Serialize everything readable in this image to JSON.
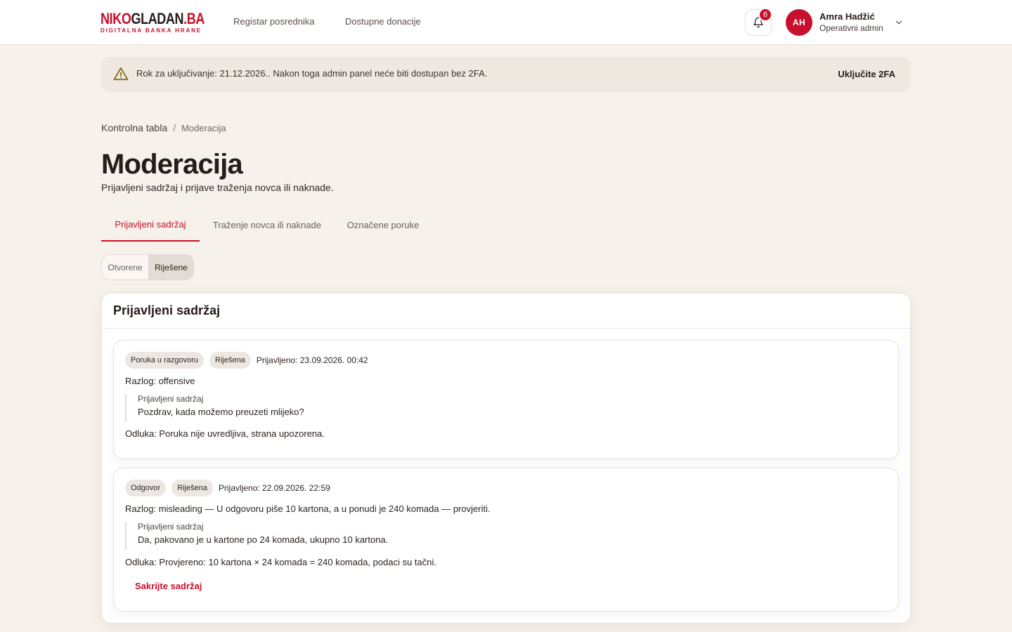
{
  "header": {
    "logo": {
      "part1": "NIKO",
      "part2": "GLADAN",
      "part3": ".BA",
      "tagline": "DIGITALNA BANKA HRANE"
    },
    "nav": [
      {
        "label": "Registar posrednika"
      },
      {
        "label": "Dostupne donacije"
      }
    ],
    "notifications": {
      "count": "6",
      "icon": "bell-icon"
    },
    "user": {
      "initials": "AH",
      "name": "Amra Hadžić",
      "role": "Operativni admin"
    }
  },
  "banner": {
    "icon": "warning-icon",
    "text": "Rok za uključivanje: 21.12.2026.. Nakon toga admin panel neće biti dostupan bez 2FA.",
    "action": "Uključite 2FA"
  },
  "breadcrumb": {
    "home": "Kontrolna tabla",
    "separator": "/",
    "current": "Moderacija"
  },
  "page": {
    "title": "Moderacija",
    "subtitle": "Prijavljeni sadržaj i prijave traženja novca ili naknade."
  },
  "tabs": [
    {
      "label": "Prijavljeni sadržaj",
      "active": true
    },
    {
      "label": "Traženje novca ili naknade",
      "active": false
    },
    {
      "label": "Označene poruke",
      "active": false
    }
  ],
  "status_filter": {
    "options": [
      "Otvorene",
      "Riješene"
    ],
    "selected": "Riješene"
  },
  "card": {
    "title": "Prijavljeni sadržaj",
    "reports": [
      {
        "type": "Poruka u razgovoru",
        "status": "Riješena",
        "reported_at": "Prijavljeno: 23.09.2026. 00:42",
        "reason": "Razlog: offensive",
        "quote_label": "Prijavljeni sadržaj",
        "quote_text": "Pozdrav, kada možemo preuzeti mlijeko?",
        "decision": "Odluka: Poruka nije uvredljiva, strana upozorena."
      },
      {
        "type": "Odgovor",
        "status": "Riješena",
        "reported_at": "Prijavljeno: 22.09.2026. 22:59",
        "reason": "Razlog: misleading — U odgovoru piše 10 kartona, a u ponudi je 240 komada — provjeriti.",
        "quote_label": "Prijavljeni sadržaj",
        "quote_text": "Da, pakovano je u kartone po 24 komada, ukupno 10 kartona.",
        "decision": "Odluka: Provjereno: 10 kartona × 24 komada = 240 komada, podaci su tačni.",
        "action": "Sakrijte sadržaj"
      }
    ]
  },
  "colors": {
    "brand": "#c8102e",
    "background": "#f6f1ea",
    "banner": "#efe8e0",
    "text": "#241d1b"
  }
}
